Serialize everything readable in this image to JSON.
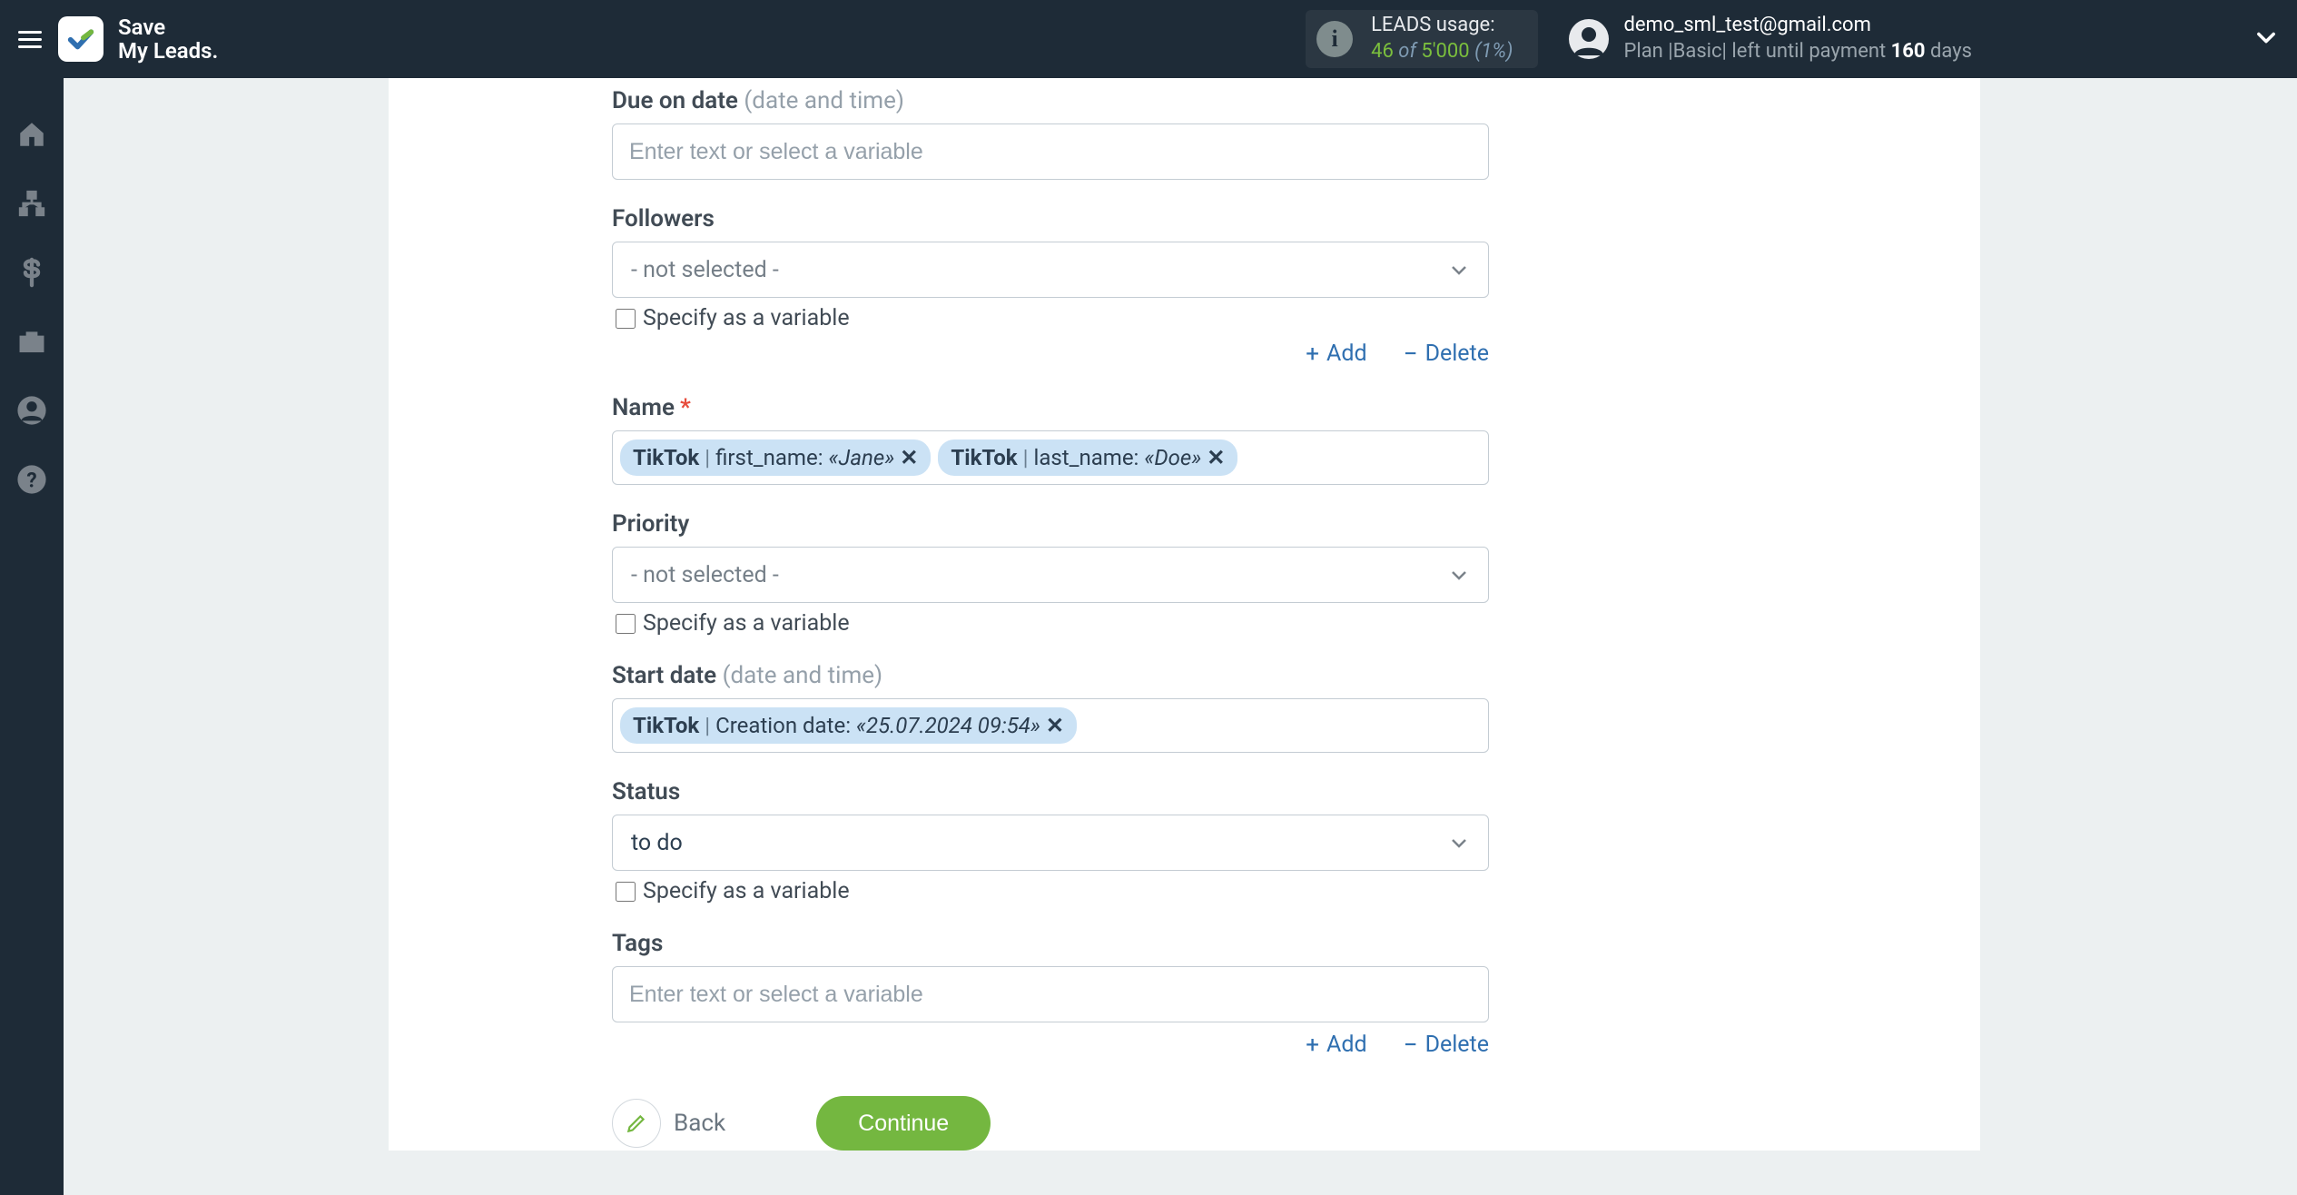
{
  "brand": {
    "line1": "Save",
    "line2": "My Leads."
  },
  "usage": {
    "title": "LEADS usage:",
    "used": "46",
    "of": "of",
    "total": "5'000",
    "percent": "(1%)"
  },
  "user": {
    "email": "demo_sml_test@gmail.com",
    "plan_prefix": "Plan |Basic| left until payment",
    "days_value": "160",
    "days_suffix": "days"
  },
  "placeholders": {
    "text_or_variable": "Enter text or select a variable"
  },
  "common": {
    "not_selected": "- not selected -",
    "specify_variable": "Specify as a variable",
    "add": "Add",
    "delete": "Delete",
    "back": "Back",
    "continue": "Continue"
  },
  "fields": {
    "due": {
      "label": "Due on date",
      "hint": "(date and time)"
    },
    "followers": {
      "label": "Followers"
    },
    "name": {
      "label": "Name"
    },
    "priority": {
      "label": "Priority"
    },
    "start": {
      "label": "Start date",
      "hint": "(date and time)"
    },
    "status": {
      "label": "Status",
      "value": "to do"
    },
    "tags": {
      "label": "Tags"
    }
  },
  "chips": {
    "name": [
      {
        "source": "TikTok",
        "field": "first_name:",
        "value": "«Jane»"
      },
      {
        "source": "TikTok",
        "field": "last_name:",
        "value": "«Doe»"
      }
    ],
    "start": [
      {
        "source": "TikTok",
        "field": "Creation date:",
        "value": "«25.07.2024 09:54»"
      }
    ]
  }
}
